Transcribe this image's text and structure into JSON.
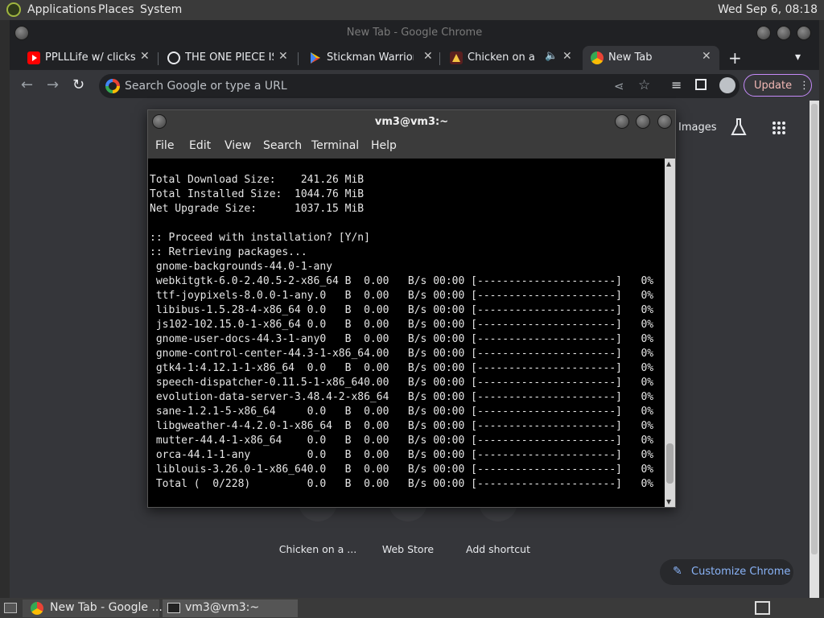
{
  "top_panel": {
    "menus": [
      "Applications",
      "Places",
      "System"
    ],
    "clock": "Wed Sep  6, 08:18"
  },
  "chrome": {
    "window_title": "New Tab - Google Chrome",
    "tabs": [
      {
        "title": "PPLLLife w/ clicks |",
        "favicon": "youtube-icon"
      },
      {
        "title": "THE ONE PIECE IS",
        "favicon": "globe-icon"
      },
      {
        "title": "Stickman Warriors",
        "favicon": "play-store-icon"
      },
      {
        "title": "Chicken on a Ra",
        "favicon": "chicken-icon",
        "audio": true
      },
      {
        "title": "New Tab",
        "favicon": "chrome-icon",
        "active": true
      }
    ],
    "omnibox_placeholder": "Search Google or type a URL",
    "update_label": "Update",
    "images_link": "Images",
    "shortcuts": [
      "Chicken on a ...",
      "Web Store",
      "Add shortcut"
    ],
    "customize_label": "Customize Chrome"
  },
  "terminal": {
    "title": "vm3@vm3:~",
    "menus": [
      "File",
      "Edit",
      "View",
      "Search",
      "Terminal",
      "Help"
    ],
    "lines": [
      "Total Download Size:    241.26 MiB",
      "Total Installed Size:  1044.76 MiB",
      "Net Upgrade Size:      1037.15 MiB",
      "",
      ":: Proceed with installation? [Y/n]",
      ":: Retrieving packages...",
      " gnome-backgrounds-44.0-1-any",
      " webkitgtk-6.0-2.40.5-2-x86_64 B  0.00   B/s 00:00 [----------------------]   0%",
      " ttf-joypixels-8.0.0-1-any.0   B  0.00   B/s 00:00 [----------------------]   0%",
      " libibus-1.5.28-4-x86_64 0.0   B  0.00   B/s 00:00 [----------------------]   0%",
      " js102-102.15.0-1-x86_64 0.0   B  0.00   B/s 00:00 [----------------------]   0%",
      " gnome-user-docs-44.3-1-any0   B  0.00   B/s 00:00 [----------------------]   0%",
      " gnome-control-center-44.3-1-x86_64.00   B/s 00:00 [----------------------]   0%",
      " gtk4-1:4.12.1-1-x86_64  0.0   B  0.00   B/s 00:00 [----------------------]   0%",
      " speech-dispatcher-0.11.5-1-x86_640.00   B/s 00:00 [----------------------]   0%",
      " evolution-data-server-3.48.4-2-x86_64   B/s 00:00 [----------------------]   0%",
      " sane-1.2.1-5-x86_64     0.0   B  0.00   B/s 00:00 [----------------------]   0%",
      " libgweather-4-4.2.0-1-x86_64  B  0.00   B/s 00:00 [----------------------]   0%",
      " mutter-44.4-1-x86_64    0.0   B  0.00   B/s 00:00 [----------------------]   0%",
      " orca-44.1-1-any         0.0   B  0.00   B/s 00:00 [----------------------]   0%",
      " liblouis-3.26.0-1-x86_640.0   B  0.00   B/s 00:00 [----------------------]   0%",
      " Total (  0/228)         0.0   B  0.00   B/s 00:00 [----------------------]   0%"
    ]
  },
  "taskbar": {
    "tasks": [
      {
        "label": "New Tab - Google ...",
        "icon": "chrome-icon"
      },
      {
        "label": "vm3@vm3:~",
        "icon": "terminal-icon"
      }
    ]
  }
}
